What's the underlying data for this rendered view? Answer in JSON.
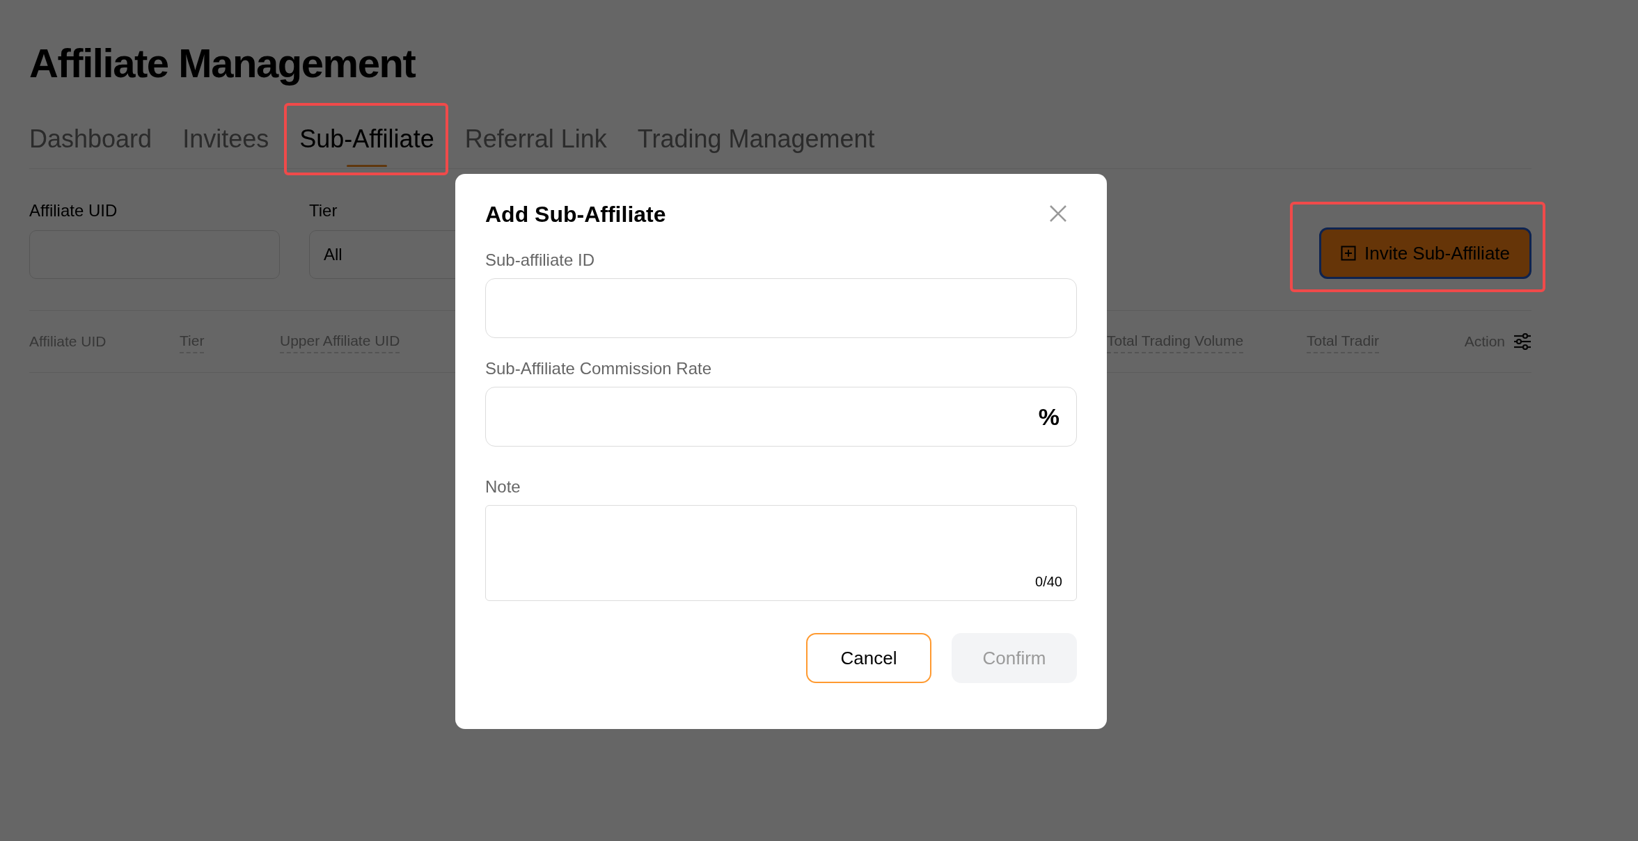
{
  "page": {
    "title": "Affiliate Management"
  },
  "tabs": [
    {
      "label": "Dashboard",
      "selected": false,
      "highlighted": false
    },
    {
      "label": "Invitees",
      "selected": false,
      "highlighted": false
    },
    {
      "label": "Sub-Affiliate",
      "selected": true,
      "highlighted": true
    },
    {
      "label": "Referral Link",
      "selected": false,
      "highlighted": false
    },
    {
      "label": "Trading Management",
      "selected": false,
      "highlighted": false
    }
  ],
  "filters": [
    {
      "kind": "input",
      "label": "Affiliate UID"
    },
    {
      "kind": "select",
      "label": "Tier",
      "value": "All"
    }
  ],
  "invite_button": {
    "label": "Invite Sub-Affiliate",
    "highlighted": true
  },
  "table": {
    "columns": [
      {
        "label": "Affiliate UID",
        "kind": "plain"
      },
      {
        "label": "Tier",
        "kind": "underlined"
      },
      {
        "label": "Upper Affiliate UID",
        "kind": "underlined"
      },
      {
        "label": "Total Trading Volume",
        "kind": "underlined"
      },
      {
        "label": "Total Tradir",
        "kind": "underlined"
      },
      {
        "label": "Action",
        "kind": "action"
      }
    ]
  },
  "dialog": {
    "title": "Add Sub-Affiliate",
    "fields": [
      {
        "kind": "text",
        "label": "Sub-affiliate ID"
      },
      {
        "kind": "percent",
        "label": "Sub-Affiliate Commission Rate",
        "suffix": "%"
      },
      {
        "kind": "textarea",
        "label": "Note",
        "counter": "0/40"
      }
    ],
    "buttons": [
      {
        "label": "Cancel",
        "kind": "secondary",
        "disabled": false
      },
      {
        "label": "Confirm",
        "kind": "primary",
        "disabled": true
      }
    ]
  }
}
